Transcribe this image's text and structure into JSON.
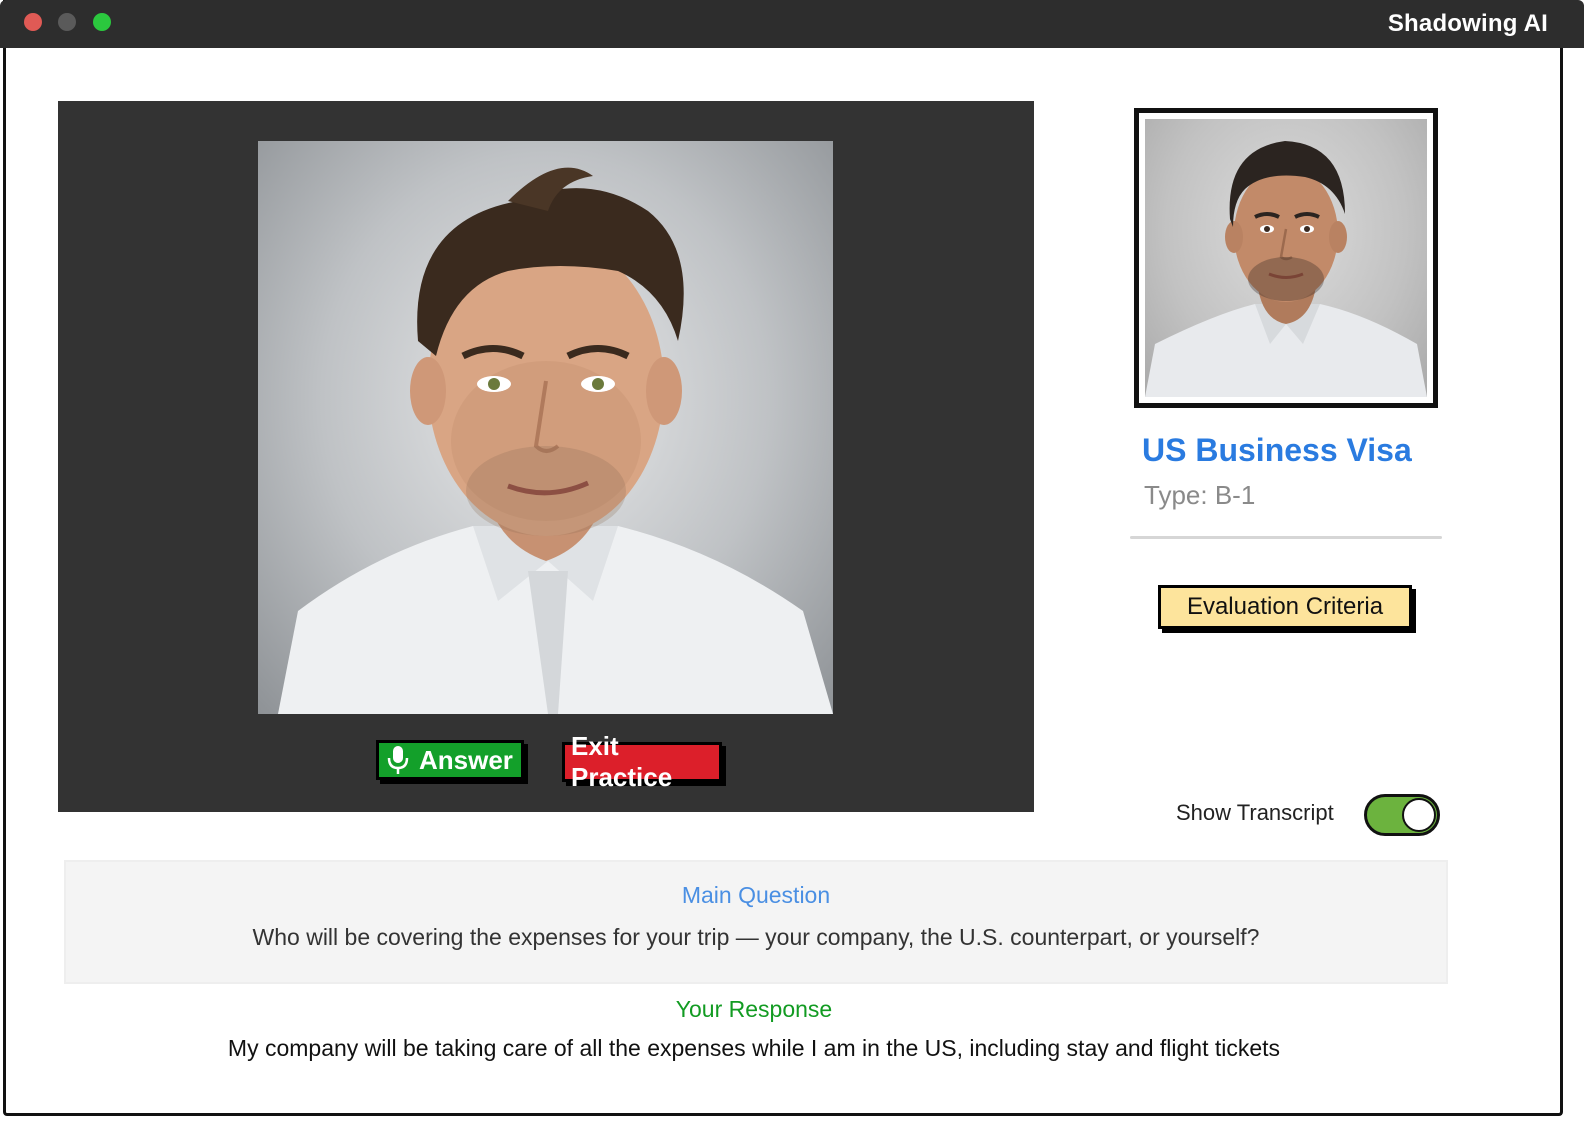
{
  "window": {
    "title": "Shadowing AI",
    "controls": [
      "close",
      "minimize",
      "maximize"
    ]
  },
  "video": {
    "interviewer_photo": "man-portrait-white-shirt",
    "answer_button": {
      "label": "Answer",
      "icon": "microphone-icon"
    },
    "exit_button": {
      "label": "Exit Practice"
    }
  },
  "sidebar": {
    "user_photo": "man-portrait-light-shirt",
    "visa_title": "US Business Visa",
    "visa_type": "Type: B-1",
    "evaluation_button": "Evaluation Criteria",
    "transcript_toggle": {
      "label": "Show Transcript",
      "on": true
    }
  },
  "transcript": {
    "question_label": "Main Question",
    "question_text": "Who will be covering the expenses for your trip — your company, the U.S. counterpart, or yourself?",
    "response_label": "Your Response",
    "response_text": "My company will be taking care of all the expenses while I am in the US, including stay and flight tickets"
  },
  "colors": {
    "answer": "#13a02a",
    "exit": "#dc1f2a",
    "visa_title": "#2a7be0",
    "evaluation": "#fde49c",
    "toggle_on": "#6cb33e",
    "question_label": "#4a8fe3",
    "response_label": "#129b22"
  }
}
